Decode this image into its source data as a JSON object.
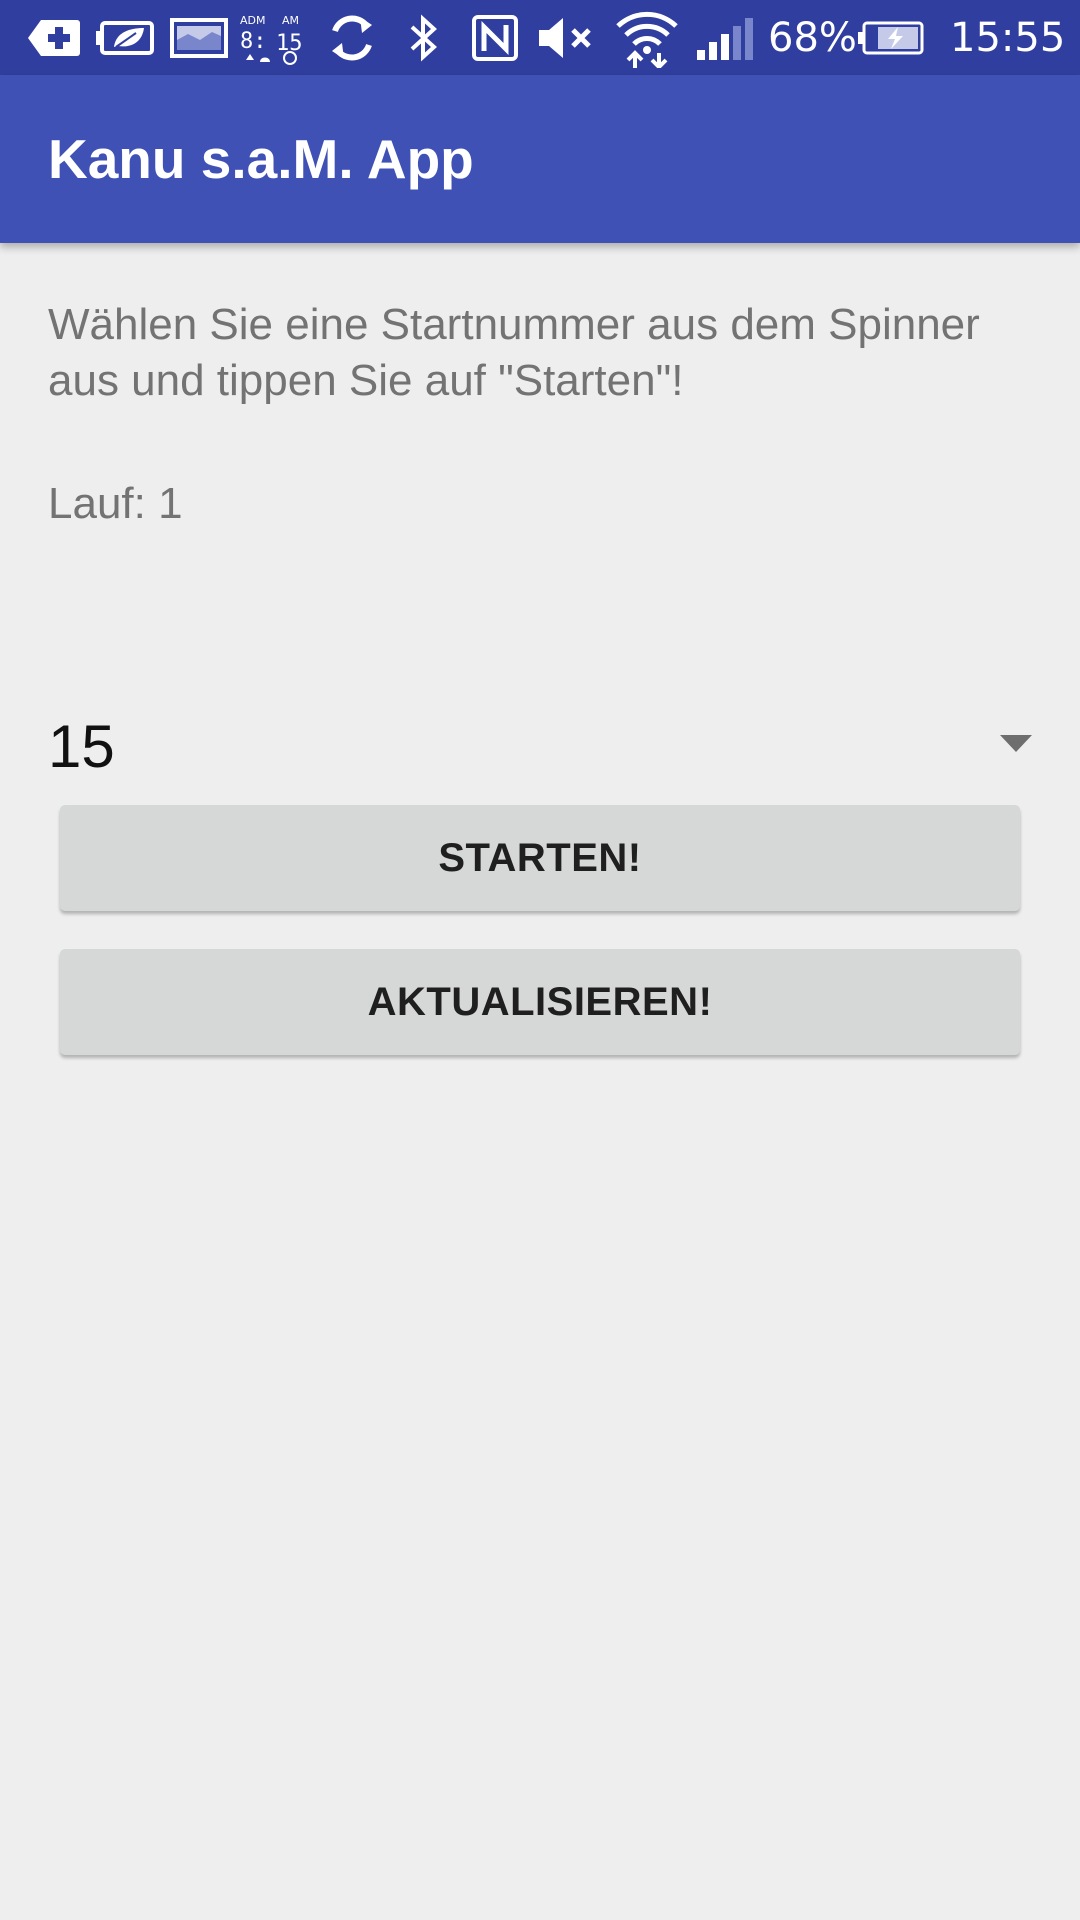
{
  "status_bar": {
    "battery_percent": "68%",
    "time": "15:55",
    "icons": [
      "add-box-icon",
      "battery-saver-icon",
      "image-icon",
      "alarm-widget-icon",
      "sync-icon",
      "bluetooth-icon",
      "nfc-icon",
      "mute-icon",
      "wifi-icon",
      "signal-icon",
      "battery-charging-icon"
    ],
    "color": "#303f9f"
  },
  "app_bar": {
    "title": "Kanu s.a.M. App",
    "color": "#3f51b5"
  },
  "main": {
    "instruction": "Wählen Sie eine Startnummer aus dem Spinner aus und tippen Sie auf \"Starten\"!",
    "lauf_label": "Lauf: ",
    "lauf_value": "1",
    "spinner_value": "15",
    "start_button": "STARTEN!",
    "refresh_button": "AKTUALISIEREN!"
  }
}
